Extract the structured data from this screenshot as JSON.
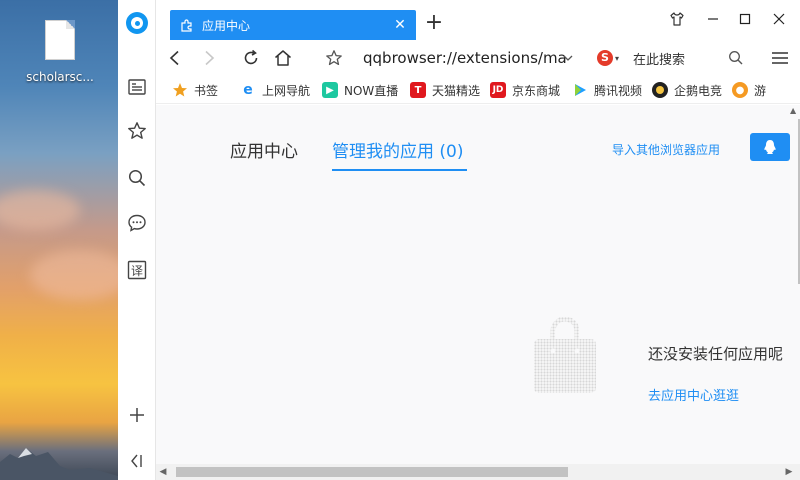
{
  "desktop": {
    "file_label": "scholarsc..."
  },
  "tab": {
    "title": "应用中心",
    "close": "✕",
    "new_tab": "+"
  },
  "address_bar": {
    "url": "qqbrowser://extensions/ma",
    "search_engine_glyph": "S",
    "search_placeholder": "在此搜索"
  },
  "bookmarks": [
    {
      "label": "书签",
      "icon": "star-icon",
      "color": "#f0a020"
    },
    {
      "label": "上网导航",
      "icon": "e-icon",
      "color": "#1f8ef3"
    },
    {
      "label": "NOW直播",
      "icon": "now-icon",
      "color": "#1dc8a0"
    },
    {
      "label": "天猫精选",
      "icon": "tmall-icon",
      "color": "#e0181e",
      "glyph": "T"
    },
    {
      "label": "京东商城",
      "icon": "jd-icon",
      "color": "#e0181e",
      "glyph": "JD"
    },
    {
      "label": "腾讯视频",
      "icon": "video-icon",
      "color": "#20a0ff"
    },
    {
      "label": "企鹅电竞",
      "icon": "penguin-icon",
      "color": "#222222"
    },
    {
      "label": "游",
      "icon": "game-icon",
      "color": "#f59a23"
    }
  ],
  "content": {
    "tab_app_center": "应用中心",
    "tab_manage": "管理我的应用 (0)",
    "import_link": "导入其他浏览器应用",
    "empty_message": "还没安装任何应用呢",
    "goto_link": "去应用中心逛逛"
  },
  "colors": {
    "accent": "#1f8ef3"
  }
}
